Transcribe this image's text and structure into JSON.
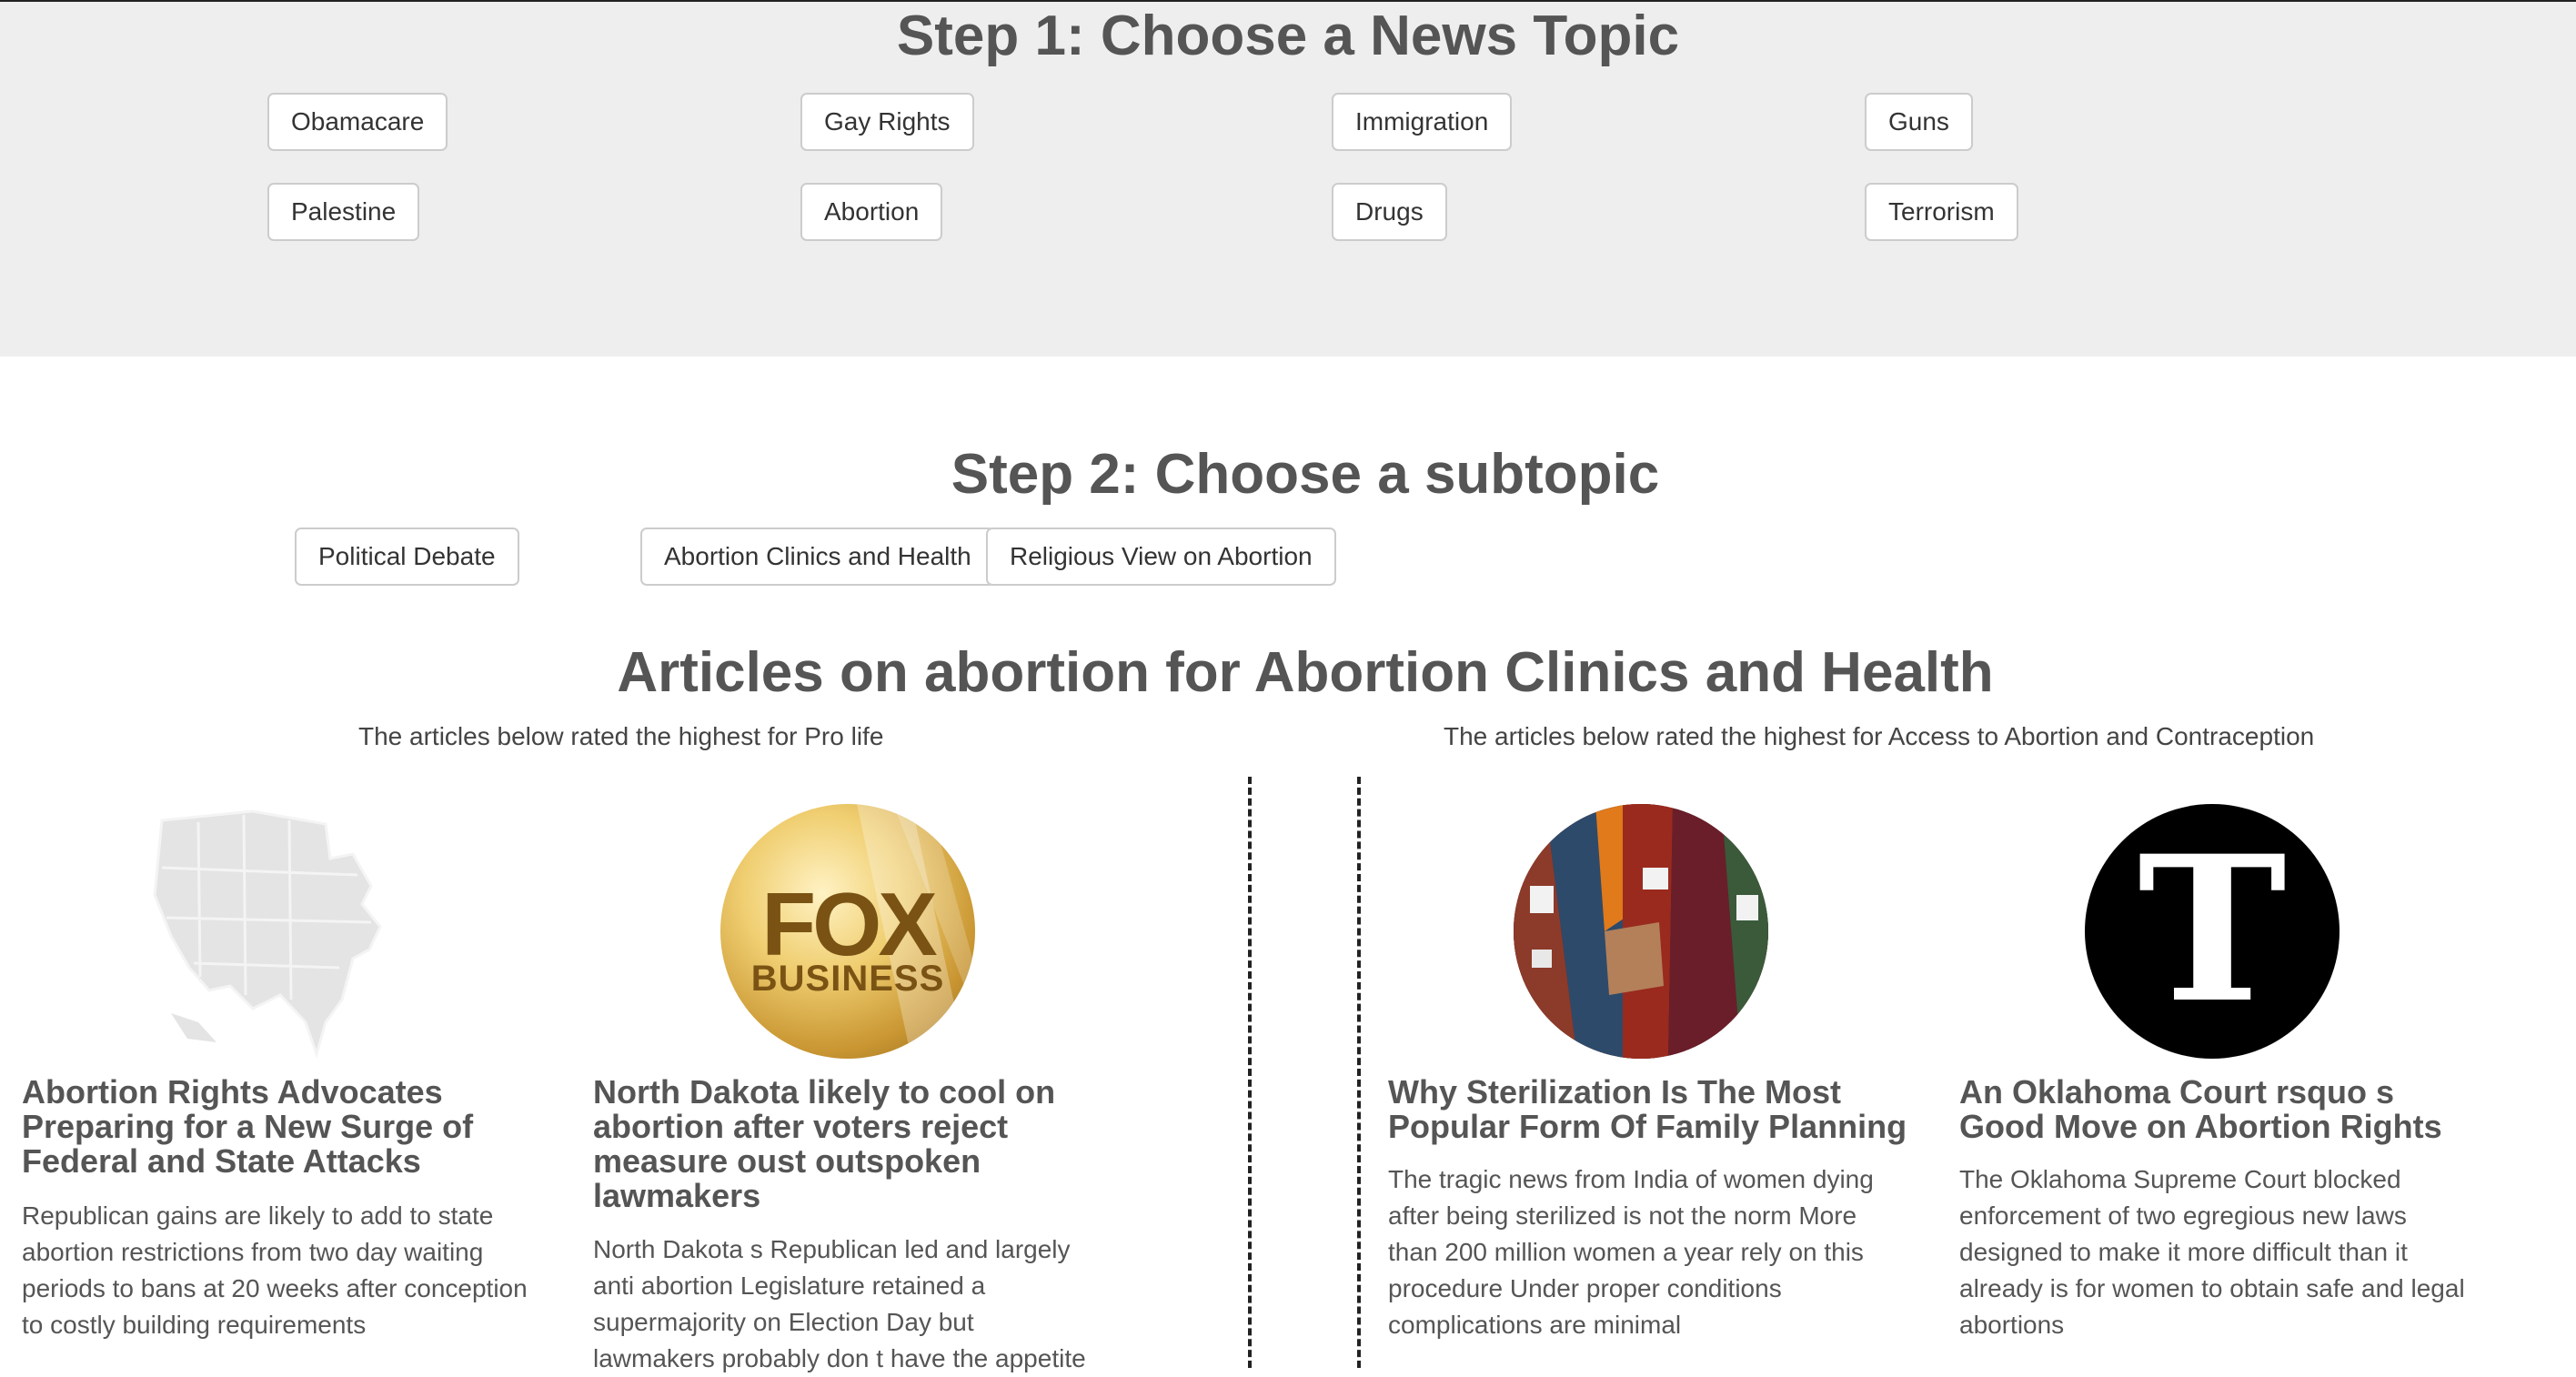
{
  "step1": {
    "heading": "Step 1: Choose a News Topic",
    "topics": [
      "Obamacare",
      "Gay Rights",
      "Immigration",
      "Guns",
      "Palestine",
      "Abortion",
      "Drugs",
      "Terrorism"
    ]
  },
  "step2": {
    "heading": "Step 2: Choose a subtopic",
    "subtopics": [
      "Political Debate",
      "Abortion Clinics and Health",
      "Religious View on Abortion"
    ]
  },
  "articles": {
    "heading": "Articles on abortion for Abortion Clinics and Health",
    "left_subheading": "The articles below rated the highest for Pro life",
    "right_subheading": "The articles below rated the highest for Access to Abortion and Contraception",
    "cards": [
      {
        "icon": "us-map-icon",
        "title": "Abortion Rights Advocates Preparing for a New Surge of Federal and State Attacks",
        "text": "Republican gains are likely to add to state abortion restrictions from two day waiting periods to bans at 20 weeks after conception to costly building requirements"
      },
      {
        "icon": "fox-business-logo",
        "logo_text_1": "FOX",
        "logo_text_2": "BUSINESS",
        "title": "North Dakota likely to cool on abortion after voters reject measure oust outspoken lawmakers",
        "text": "North Dakota s Republican led and largely anti abortion Legislature retained a supermajority on Election Day but lawmakers probably don t have the appetite"
      },
      {
        "icon": "women-photo",
        "title": "Why Sterilization Is The Most Popular Form Of Family Planning",
        "text": "The tragic news from India of women dying after being sterilized is not the norm More than 200 million women a year rely on this procedure Under proper conditions complications are minimal"
      },
      {
        "icon": "nytimes-t-logo",
        "logo_text": "T",
        "title": "An Oklahoma Court rsquo s Good Move on Abortion Rights",
        "text": "The Oklahoma Supreme Court blocked enforcement of two egregious new laws designed to make it more difficult than it already is for women to obtain safe and legal abortions"
      }
    ]
  },
  "colors": {
    "panel_bg": "#eeeeee",
    "heading": "#555555",
    "button_border": "#cccccc"
  }
}
